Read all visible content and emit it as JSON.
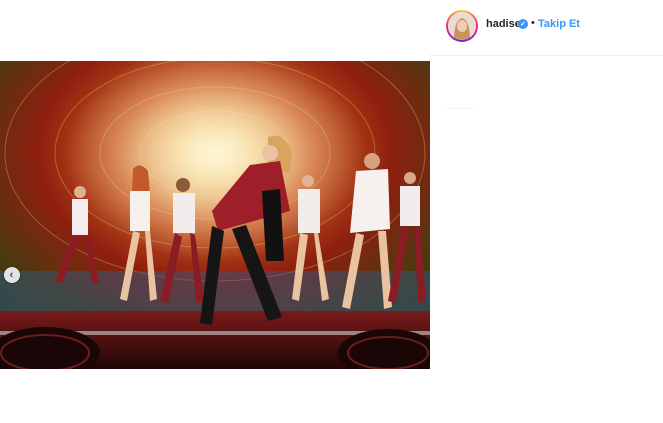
{
  "post": {
    "username": "hadise",
    "follow_label": "Takip Et",
    "separator": "•"
  },
  "icons": {
    "verified": "verified-badge-icon",
    "prev": "chevron-left-icon"
  },
  "colors": {
    "link_blue": "#3897f0",
    "text_dark": "#262626",
    "divider": "#efefef"
  }
}
